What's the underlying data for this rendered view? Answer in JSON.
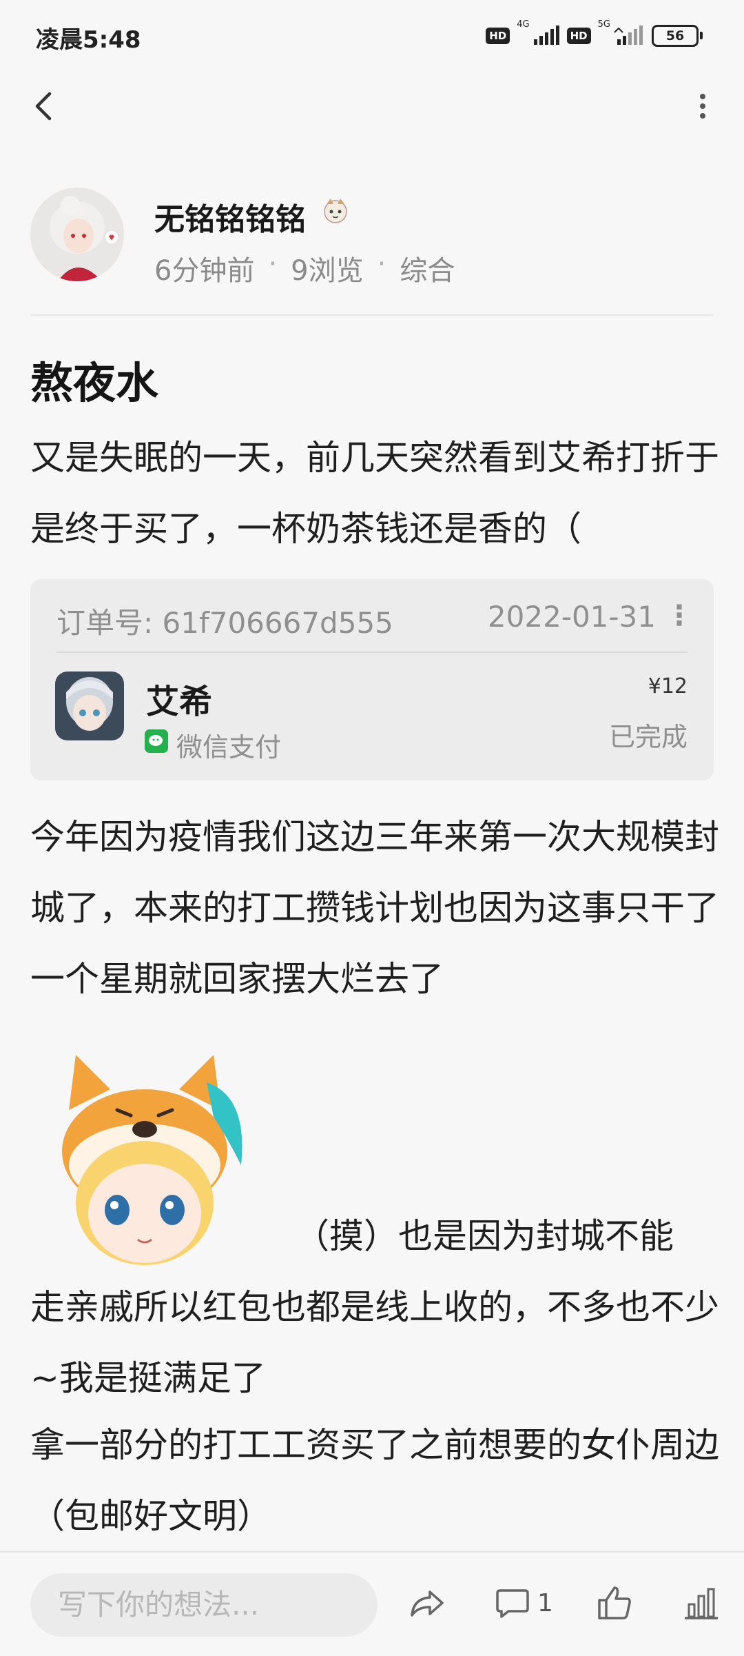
{
  "status_bar": {
    "time": "凌晨5:48",
    "hd1": "HD",
    "net1": "4G",
    "hd2": "HD",
    "net2": "5G",
    "battery": "56"
  },
  "author": {
    "name": "无铭铭铭铭",
    "time_ago": "6分钟前",
    "views": "9浏览",
    "category": "综合",
    "separator": "·"
  },
  "post": {
    "title": "熬夜水",
    "para1": "又是失眠的一天，前几天突然看到艾希打折于是终于买了，一杯奶茶钱还是香的（",
    "para2": "今年因为疫情我们这边三年来第一次大规模封城了，本来的打工攒钱计划也因为这事只干了一个星期就回家摆大烂去了",
    "para3_line1": "（摸）也是因为封城不能",
    "para3_rest": "走亲戚所以红包也都是线上收的，不多也不少~我是挺满足了",
    "para4": "拿一部分的打工工资买了之前想要的女仆周边（包邮好文明）"
  },
  "order": {
    "order_no": "订单号: 61f706667d555",
    "date": "2022-01-31",
    "more": "⋮",
    "app_name": "艾希",
    "pay_method": "微信支付",
    "price": "¥12",
    "status": "已完成"
  },
  "bottom_bar": {
    "input_placeholder": "写下你的想法...",
    "comment_count": "1"
  },
  "colors": {
    "background": "#f7f7f7",
    "card": "#ececec",
    "wechat_green": "#22b14c",
    "muted_text": "#8a8a8a"
  }
}
